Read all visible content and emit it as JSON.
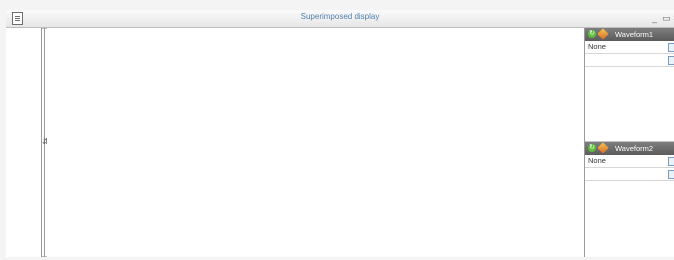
{
  "window": {
    "title": "Superimposed display"
  },
  "waveforms": [
    {
      "name": "Waveform1",
      "value": "None"
    },
    {
      "name": "Waveform2",
      "value": "None"
    }
  ]
}
